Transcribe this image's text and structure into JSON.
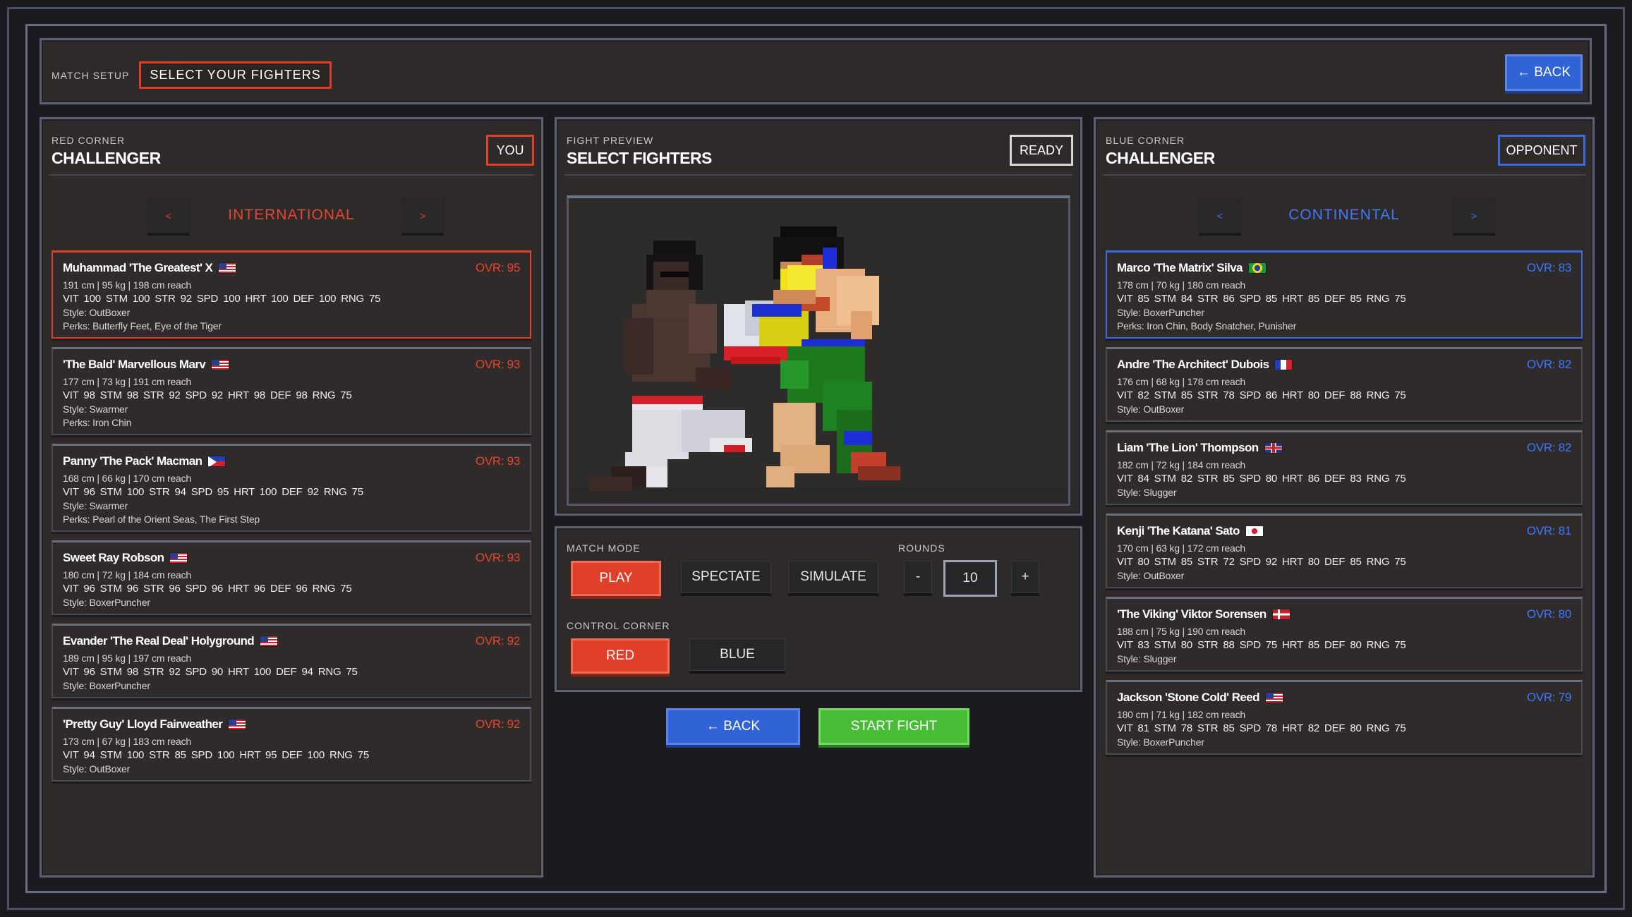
{
  "header": {
    "label": "MATCH SETUP",
    "title": "SELECT YOUR FIGHTERS",
    "back_label": "← BACK"
  },
  "red": {
    "corner_label": "RED CORNER",
    "title": "CHALLENGER",
    "badge": "YOU",
    "region": "INTERNATIONAL",
    "prev": "<",
    "next": ">",
    "fighters": [
      {
        "name": "Muhammad 'The Greatest' X",
        "flag": "us",
        "ovr": "OVR: 95",
        "info": "191 cm | 95 kg | 198 cm reach",
        "stats": "VIT 100 STM 100 STR 92 SPD 100 HRT 100 DEF 100 RNG 75",
        "style": "Style: OutBoxer",
        "perks": "Perks: Butterfly Feet, Eye of the Tiger"
      },
      {
        "name": "'The Bald' Marvellous Marv",
        "flag": "us",
        "ovr": "OVR: 93",
        "info": "177 cm | 73 kg | 191 cm reach",
        "stats": "VIT 98 STM 98 STR 92 SPD 92 HRT 98 DEF 98 RNG 75",
        "style": "Style: Swarmer",
        "perks": "Perks: Iron Chin"
      },
      {
        "name": "Panny 'The Pack' Macman",
        "flag": "ph",
        "ovr": "OVR: 93",
        "info": "168 cm | 66 kg | 170 cm reach",
        "stats": "VIT 96 STM 100 STR 94 SPD 95 HRT 100 DEF 92 RNG 75",
        "style": "Style: Swarmer",
        "perks": "Perks: Pearl of the Orient Seas, The First Step"
      },
      {
        "name": "Sweet Ray Robson",
        "flag": "us",
        "ovr": "OVR: 93",
        "info": "180 cm | 72 kg | 184 cm reach",
        "stats": "VIT 96 STM 96 STR 96 SPD 96 HRT 96 DEF 96 RNG 75",
        "style": "Style: BoxerPuncher",
        "perks": ""
      },
      {
        "name": "Evander 'The Real Deal' Holyground",
        "flag": "us",
        "ovr": "OVR: 92",
        "info": "189 cm | 95 kg | 197 cm reach",
        "stats": "VIT 96 STM 98 STR 92 SPD 90 HRT 100 DEF 94 RNG 75",
        "style": "Style: BoxerPuncher",
        "perks": ""
      },
      {
        "name": "'Pretty Guy' Lloyd Fairweather",
        "flag": "us",
        "ovr": "OVR: 92",
        "info": "173 cm | 67 kg | 183 cm reach",
        "stats": "VIT 94 STM 100 STR 85 SPD 100 HRT 95 DEF 100 RNG 75",
        "style": "Style: OutBoxer",
        "perks": ""
      }
    ]
  },
  "blue": {
    "corner_label": "BLUE CORNER",
    "title": "CHALLENGER",
    "badge": "OPPONENT",
    "region": "CONTINENTAL",
    "prev": "<",
    "next": ">",
    "fighters": [
      {
        "name": "Marco 'The Matrix' Silva",
        "flag": "br",
        "ovr": "OVR: 83",
        "info": "178 cm | 70 kg | 180 cm reach",
        "stats": "VIT 85 STM 84 STR 86 SPD 85 HRT 85 DEF 85 RNG 75",
        "style": "Style: BoxerPuncher",
        "perks": "Perks: Iron Chin, Body Snatcher, Punisher"
      },
      {
        "name": "Andre 'The Architect' Dubois",
        "flag": "fr",
        "ovr": "OVR: 82",
        "info": "176 cm | 68 kg | 178 cm reach",
        "stats": "VIT 82 STM 85 STR 78 SPD 86 HRT 80 DEF 88 RNG 75",
        "style": "Style: OutBoxer",
        "perks": ""
      },
      {
        "name": "Liam 'The Lion' Thompson",
        "flag": "gb",
        "ovr": "OVR: 82",
        "info": "182 cm | 72 kg | 184 cm reach",
        "stats": "VIT 84 STM 82 STR 85 SPD 80 HRT 86 DEF 83 RNG 75",
        "style": "Style: Slugger",
        "perks": ""
      },
      {
        "name": "Kenji 'The Katana' Sato",
        "flag": "jp",
        "ovr": "OVR: 81",
        "info": "170 cm | 63 kg | 172 cm reach",
        "stats": "VIT 80 STM 85 STR 72 SPD 92 HRT 80 DEF 85 RNG 75",
        "style": "Style: OutBoxer",
        "perks": ""
      },
      {
        "name": "'The Viking' Viktor Sorensen",
        "flag": "dk",
        "ovr": "OVR: 80",
        "info": "188 cm | 75 kg | 190 cm reach",
        "stats": "VIT 83 STM 80 STR 88 SPD 75 HRT 85 DEF 80 RNG 75",
        "style": "Style: Slugger",
        "perks": ""
      },
      {
        "name": "Jackson 'Stone Cold' Reed",
        "flag": "us",
        "ovr": "OVR: 79",
        "info": "180 cm | 71 kg | 182 cm reach",
        "stats": "VIT 81 STM 78 STR 85 SPD 78 HRT 82 DEF 80 RNG 75",
        "style": "Style: BoxerPuncher",
        "perks": ""
      }
    ]
  },
  "preview": {
    "label": "FIGHT PREVIEW",
    "title": "SELECT FIGHTERS",
    "badge": "READY"
  },
  "mode": {
    "label": "MATCH MODE",
    "play": "PLAY",
    "spectate": "SPECTATE",
    "simulate": "SIMULATE",
    "rounds_label": "ROUNDS",
    "minus": "-",
    "plus": "+",
    "rounds": "10",
    "control_label": "CONTROL CORNER",
    "red": "RED",
    "blue": "BLUE"
  },
  "footer": {
    "back": "← BACK",
    "start": "START FIGHT"
  },
  "colors": {
    "red": "#e0402a",
    "blue": "#2f63d6",
    "green": "#47bd35",
    "red_text": "#e8452e",
    "blue_text": "#3d78ff"
  }
}
